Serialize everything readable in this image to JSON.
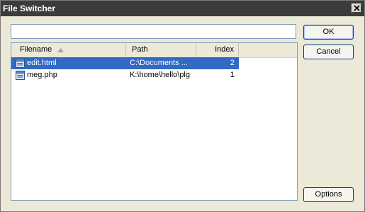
{
  "window": {
    "title": "File Switcher"
  },
  "search": {
    "value": "",
    "placeholder": ""
  },
  "list": {
    "headers": {
      "filename": "Filename",
      "path": "Path",
      "index": "Index"
    },
    "rows": [
      {
        "filename": "edit.html",
        "path": "C:\\Documents ...",
        "index": "2",
        "icon": "file-icon"
      },
      {
        "filename": "meg.php",
        "path": "K:\\home\\hello\\plg",
        "index": "1",
        "icon": "file-icon"
      }
    ]
  },
  "buttons": {
    "ok": "OK",
    "cancel": "Cancel",
    "options": "Options"
  },
  "colors": {
    "selection": "#316ac5",
    "titlebar": "#3c3c3c"
  }
}
